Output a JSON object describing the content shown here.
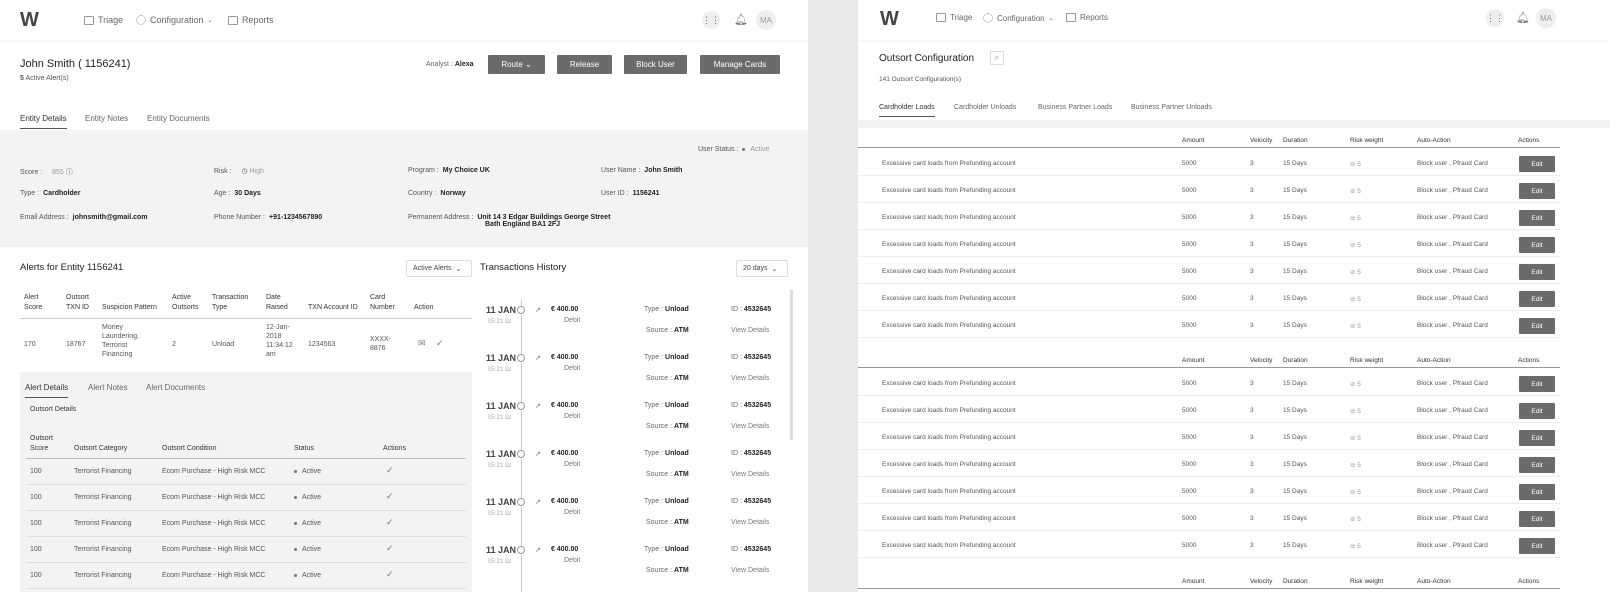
{
  "left": {
    "nav": {
      "logo": "W",
      "triage": "Triage",
      "configuration": "Configuration",
      "reports": "Reports",
      "avatar": "MA",
      "apps_icon": "grid-icon",
      "bell_icon": "bell-icon"
    },
    "header": {
      "title": "John Smith ( 1156241)",
      "alerts_count": "5",
      "alerts_label": "Active Alert(s)",
      "analyst_label": "Analyst :",
      "analyst_name": "Alexa",
      "route": "Route",
      "release": "Release",
      "block": "Block User",
      "manage": "Manage Cards"
    },
    "tabs": [
      "Entity Details",
      "Entity Notes",
      "Entity Documents"
    ],
    "user_status": {
      "label": "User Status :",
      "value": "Active"
    },
    "details": {
      "score_label": "Score :",
      "score": "855",
      "risk_label": "Risk :",
      "risk": "High",
      "program_label": "Program :",
      "program": "My Choice UK",
      "username_label": "User Name :",
      "username": "John Smith",
      "type_label": "Type :",
      "type": "Cardholder",
      "age_label": "Age :",
      "age": "30 Days",
      "country_label": "Country :",
      "country": "Norway",
      "userid_label": "User ID :",
      "userid": "1156241",
      "email_label": "Email Address :",
      "email": "johnsmith@gmail.com",
      "phone_label": "Phone Number :",
      "phone": "+91-1234567890",
      "address_label": "Permanent Address :",
      "address1": "Unit 14 3 Edgar Buildings George Street",
      "address2": "Bath England BA1 2FJ"
    },
    "alerts": {
      "title": "Alerts for Entity 1156241",
      "filter": "Active Alerts",
      "headers": [
        "Alert Score",
        "Outsort TXN ID",
        "Suspicion Pattern",
        "Active Outsorts",
        "Transaction Type",
        "Date Raised",
        "TXN Account ID",
        "Card Number",
        "Action"
      ],
      "row": {
        "score": "170",
        "txn": "18767",
        "pattern": "Money Laundering, Terrorist Financing",
        "outsorts": "2",
        "type": "Unload",
        "date": "12-Jan-2018 11:34:12 am",
        "account": "1234563",
        "card": "XXXX-8876"
      },
      "subtabs": [
        "Alert Details",
        "Alert Notes",
        "Alert Documents"
      ],
      "subtitle": "Outsort Details",
      "sub_headers": [
        "Outsort Score",
        "Outsort Category",
        "Outsort Condition",
        "Status",
        "Actions"
      ],
      "sub_rows": [
        {
          "score": "100",
          "category": "Terrorist Financing",
          "condition": "Ecom Purchase - High Risk MCC",
          "status": "Active"
        },
        {
          "score": "100",
          "category": "Terrorist Financing",
          "condition": "Ecom Purchase - High Risk MCC",
          "status": "Active"
        },
        {
          "score": "100",
          "category": "Terrorist Financing",
          "condition": "Ecom Purchase - High Risk MCC",
          "status": "Active"
        },
        {
          "score": "100",
          "category": "Terrorist Financing",
          "condition": "Ecom Purchase - High Risk MCC",
          "status": "Active"
        },
        {
          "score": "100",
          "category": "Terrorist Financing",
          "condition": "Ecom Purchase - High Risk MCC",
          "status": "Active"
        }
      ]
    },
    "transactions": {
      "title": "Transactions History",
      "filter": "20 days",
      "items": [
        {
          "date": "11 JAN",
          "time": "05:21:32",
          "amount": "€ 400.00",
          "dir": "Debit",
          "type_label": "Type :",
          "type": "Unload",
          "source_label": "Source :",
          "source": "ATM",
          "id_label": "ID :",
          "id": "4532645",
          "link": "View Details"
        },
        {
          "date": "11 JAN",
          "time": "05:21:32",
          "amount": "€ 400.00",
          "dir": "Debit",
          "type_label": "Type :",
          "type": "Unload",
          "source_label": "Source :",
          "source": "ATM",
          "id_label": "ID :",
          "id": "4532645",
          "link": "View Details"
        },
        {
          "date": "11 JAN",
          "time": "05:21:32",
          "amount": "€ 400.00",
          "dir": "Debit",
          "type_label": "Type :",
          "type": "Unload",
          "source_label": "Source :",
          "source": "ATM",
          "id_label": "ID :",
          "id": "4532645",
          "link": "View Details"
        },
        {
          "date": "11 JAN",
          "time": "05:21:32",
          "amount": "€ 400.00",
          "dir": "Debit",
          "type_label": "Type :",
          "type": "Unload",
          "source_label": "Source :",
          "source": "ATM",
          "id_label": "ID :",
          "id": "4532645",
          "link": "View Details"
        },
        {
          "date": "11 JAN",
          "time": "05:21:32",
          "amount": "€ 400.00",
          "dir": "Debit",
          "type_label": "Type :",
          "type": "Unload",
          "source_label": "Source :",
          "source": "ATM",
          "id_label": "ID :",
          "id": "4532645",
          "link": "View Details"
        },
        {
          "date": "11 JAN",
          "time": "05:21:32",
          "amount": "€ 400.00",
          "dir": "Debit",
          "type_label": "Type :",
          "type": "Unload",
          "source_label": "Source :",
          "source": "ATM",
          "id_label": "ID :",
          "id": "4532645",
          "link": "View Details"
        }
      ]
    }
  },
  "right": {
    "nav": {
      "logo": "W",
      "triage": "Triage",
      "configuration": "Configuration",
      "reports": "Reports",
      "avatar": "MA"
    },
    "title": "Outsort Configuration",
    "count": "141 Outsort Configuration(s)",
    "tabs": [
      "Cardholder Loads",
      "Cardholder Unloads",
      "Business Partner Loads",
      "Business Partner Unloads"
    ],
    "headers": [
      "Amount",
      "Velocity",
      "Duration",
      "Risk weight",
      "Auto-Action",
      "Actions"
    ],
    "row_template": {
      "desc": "Excessive card loads from Prefunding account",
      "amount": "5000",
      "velocity": "3",
      "duration": "15 Days",
      "risk": "5",
      "action": "Block user , Pfraud Card",
      "edit": "Edit"
    },
    "group1_rows": 7,
    "group2_rows": 7
  }
}
